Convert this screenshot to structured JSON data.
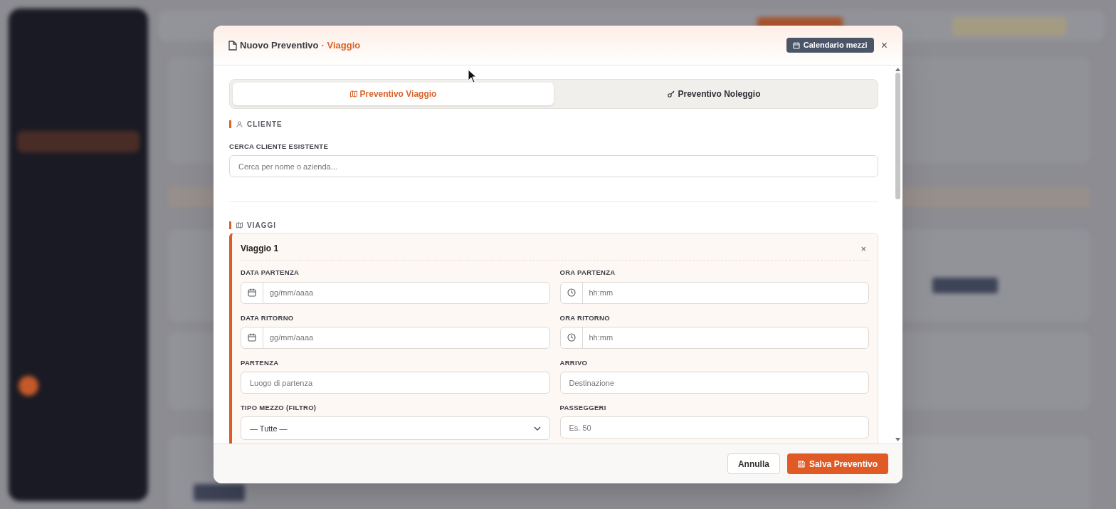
{
  "dialog": {
    "title": "Nuovo Preventivo",
    "title_suffix": "· Viaggio",
    "calendar_button": "Calendario mezzi",
    "close": "×"
  },
  "tabs": [
    {
      "label": "Preventivo Viaggio",
      "selected": true
    },
    {
      "label": "Preventivo Noleggio",
      "selected": false
    }
  ],
  "client_section": {
    "title": "CLIENTE",
    "field_label": "CERCA CLIENTE ESISTENTE",
    "placeholder": "Cerca per nome o azienda..."
  },
  "trips_section": {
    "title": "VIAGGI",
    "trips": [
      {
        "title": "Viaggio 1",
        "remove": "×",
        "fields": [
          {
            "kind": "date",
            "label": "DATA PARTENZA",
            "placeholder": "gg/mm/aaaa"
          },
          {
            "kind": "time",
            "label": "ORA PARTENZA",
            "placeholder": "hh:mm"
          },
          {
            "kind": "date",
            "label": "DATA RITORNO",
            "placeholder": "gg/mm/aaaa"
          },
          {
            "kind": "time",
            "label": "ORA RITORNO",
            "placeholder": "hh:mm"
          },
          {
            "kind": "text",
            "label": "PARTENZA",
            "placeholder": "Luogo di partenza"
          },
          {
            "kind": "text",
            "label": "ARRIVO",
            "placeholder": "Destinazione"
          },
          {
            "kind": "select",
            "label": "TIPO MEZZO (FILTRO)",
            "value": "— Tutte —"
          },
          {
            "kind": "text",
            "label": "PASSEGGERI",
            "placeholder": "Es. 50"
          }
        ]
      }
    ]
  },
  "footer": {
    "cancel": "Annulla",
    "save": "Salva Preventivo"
  }
}
